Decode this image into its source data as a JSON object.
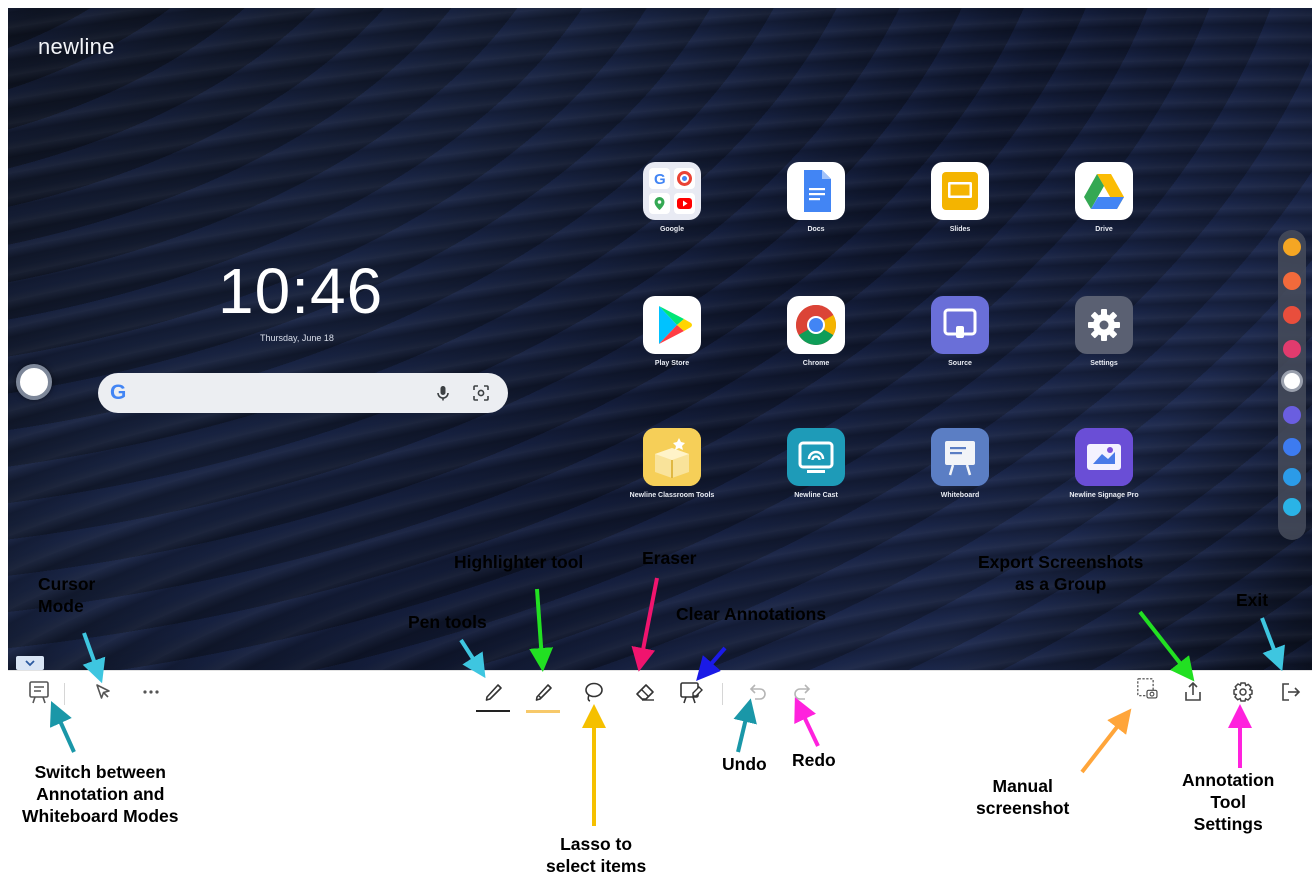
{
  "brand": "newline",
  "clock": {
    "time": "10:46",
    "date": "Thursday, June 18"
  },
  "apps": [
    {
      "label": "Google"
    },
    {
      "label": "Docs"
    },
    {
      "label": "Slides"
    },
    {
      "label": "Drive"
    },
    {
      "label": "Play Store"
    },
    {
      "label": "Chrome"
    },
    {
      "label": "Source"
    },
    {
      "label": "Settings"
    },
    {
      "label": "Newline Classroom Tools"
    },
    {
      "label": "Newline Cast"
    },
    {
      "label": "Whiteboard"
    },
    {
      "label": "Newline Signage Pro"
    }
  ],
  "sidebar_colors": [
    "#f5a623",
    "#f26a3b",
    "#e94e3c",
    "#e13b6e",
    "#ffffff",
    "#6a5ee0",
    "#3d7bf0",
    "#2b9be8",
    "#2ab3e6"
  ],
  "toolbar_icons": [
    "whiteboard-mode-icon",
    "cursor-icon",
    "more-icon",
    "pen-icon",
    "highlighter-icon",
    "lasso-icon",
    "eraser-icon",
    "clear-annotations-icon",
    "undo-icon",
    "redo-icon",
    "screenshot-icon",
    "export-icon",
    "settings-icon",
    "exit-icon"
  ],
  "callouts": {
    "cursor_mode": "Cursor\nMode",
    "pen_tools": "Pen tools",
    "highlighter": "Highlighter tool",
    "eraser": "Eraser",
    "clear_annotations": "Clear Annotations",
    "export": "Export Screenshots\nas a Group",
    "exit": "Exit",
    "switch_modes": "Switch between\nAnnotation and\nWhiteboard Modes",
    "lasso": "Lasso to\nselect items",
    "undo": "Undo",
    "redo": "Redo",
    "manual_screenshot": "Manual\nscreenshot",
    "annotation_settings": "Annotation\nTool\nSettings"
  },
  "arrow_colors": {
    "cyan": "#3ec6e0",
    "teal": "#1a97a8",
    "green": "#22e022",
    "pink": "#f0146e",
    "blue": "#1a1ae6",
    "yellow": "#f5c000",
    "magenta": "#ff22dd",
    "orange": "#ffa53a"
  }
}
